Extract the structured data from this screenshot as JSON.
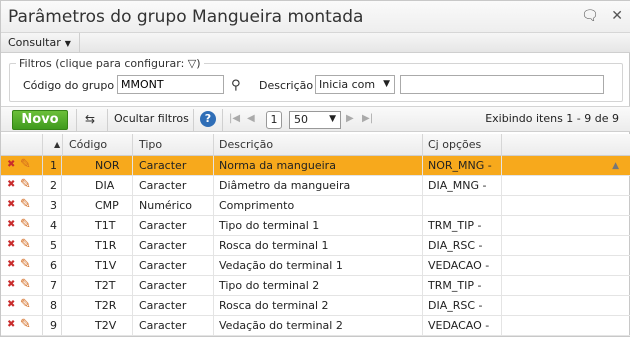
{
  "window": {
    "title": "Parâmetros do grupo Mangueira montada",
    "icons": [
      "chat-icon",
      "close-icon"
    ]
  },
  "menu": {
    "consultar_label": "Consultar"
  },
  "filters": {
    "legend": "Filtros (clique para configurar:",
    "legend_close": ")",
    "codigo_label": "Código do grupo",
    "codigo_value": "MMONT",
    "descricao_label": "Descrição",
    "descricao_mode": "Inicia com",
    "descricao_value": ""
  },
  "toolbar": {
    "novo_label": "Novo",
    "ocultar_label": "Ocultar filtros",
    "help_label": "?",
    "page": "1",
    "page_size": "50",
    "info": "Exibindo itens 1 - 9 de 9"
  },
  "columns": [
    "Código",
    "Tipo",
    "Descrição",
    "Cj opções"
  ],
  "rows": [
    {
      "n": "1",
      "codigo": "NOR",
      "tipo": "Caracter",
      "descricao": "Norma da mangueira",
      "cj": "NOR_MNG -"
    },
    {
      "n": "2",
      "codigo": "DIA",
      "tipo": "Caracter",
      "descricao": "Diâmetro da mangueira",
      "cj": "DIA_MNG -"
    },
    {
      "n": "3",
      "codigo": "CMP",
      "tipo": "Numérico",
      "descricao": "Comprimento",
      "cj": ""
    },
    {
      "n": "4",
      "codigo": "T1T",
      "tipo": "Caracter",
      "descricao": "Tipo do terminal 1",
      "cj": "TRM_TIP -"
    },
    {
      "n": "5",
      "codigo": "T1R",
      "tipo": "Caracter",
      "descricao": "Rosca do terminal 1",
      "cj": "DIA_RSC -"
    },
    {
      "n": "6",
      "codigo": "T1V",
      "tipo": "Caracter",
      "descricao": "Vedação do terminal 1",
      "cj": "VEDACAO -"
    },
    {
      "n": "7",
      "codigo": "T2T",
      "tipo": "Caracter",
      "descricao": "Tipo do terminal 2",
      "cj": "TRM_TIP -"
    },
    {
      "n": "8",
      "codigo": "T2R",
      "tipo": "Caracter",
      "descricao": "Rosca do terminal 2",
      "cj": "DIA_RSC -"
    },
    {
      "n": "9",
      "codigo": "T2V",
      "tipo": "Caracter",
      "descricao": "Vedação do terminal 2",
      "cj": "VEDACAO -"
    }
  ],
  "colors": {
    "selected_row": "#f7a91c",
    "novo_button": "#4aa822",
    "delete_icon": "#c92c2c",
    "edit_icon": "#d2691e"
  }
}
